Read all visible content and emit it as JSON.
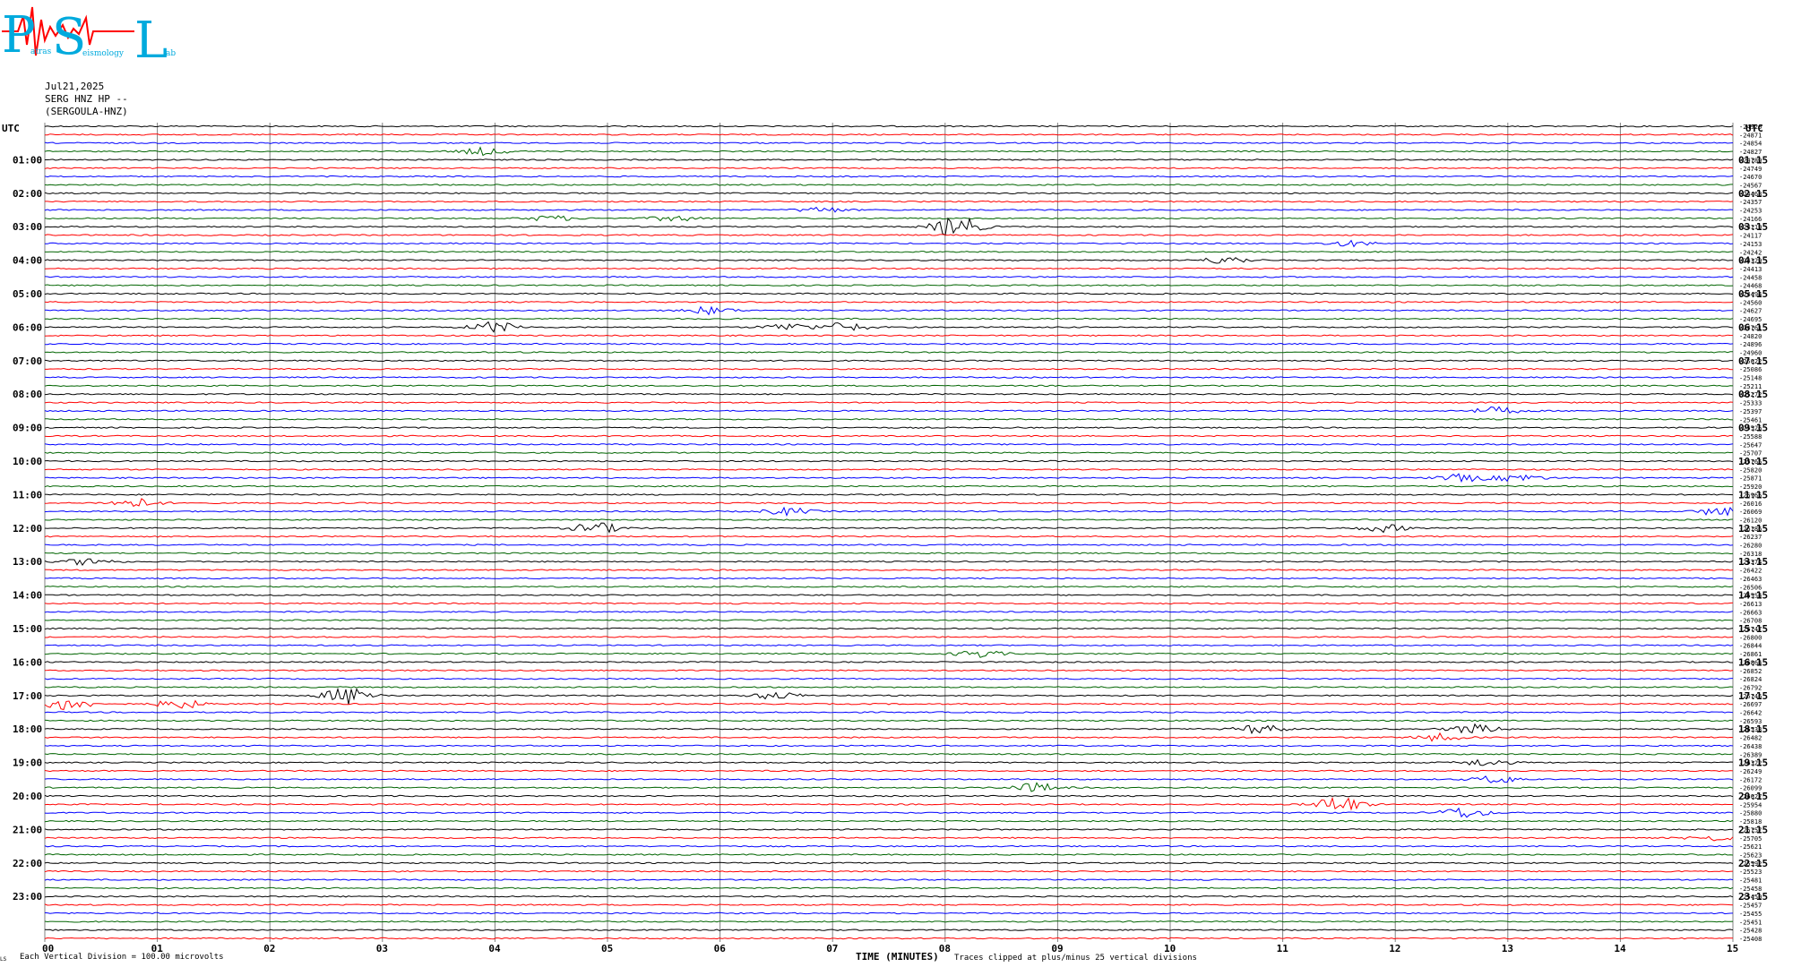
{
  "header": {
    "date": "Jul21,2025",
    "station": "SERG HNZ HP --",
    "station_name": "(SERGOULA-HNZ)"
  },
  "logo": {
    "big_letters": [
      "P",
      "S",
      "L"
    ],
    "small_words": [
      "atras",
      "eismology",
      "ab"
    ]
  },
  "utc_label_left": "UTC",
  "utc_label_right": "UTC",
  "footer": {
    "left_note": "Each Vertical Division =  100.00 microvolts",
    "x_axis_title": "TIME (MINUTES)",
    "clip_note": "Traces clipped at plus/minus 25 vertical divisions",
    "corner_mark": "LS"
  },
  "colors": {
    "black": "#000000",
    "red": "#ff0000",
    "blue": "#0000ff",
    "green": "#006400",
    "grid": "#808080"
  },
  "chart_data": {
    "type": "line",
    "x_ticks": [
      "00",
      "01",
      "02",
      "03",
      "04",
      "05",
      "06",
      "07",
      "08",
      "09",
      "10",
      "11",
      "12",
      "13",
      "14",
      "15"
    ],
    "xlim": [
      0,
      15
    ],
    "left_hour_labels": [
      "01:00",
      "02:00",
      "03:00",
      "04:00",
      "05:00",
      "06:00",
      "07:00",
      "08:00",
      "09:00",
      "10:00",
      "11:00",
      "12:00",
      "13:00",
      "14:00",
      "15:00",
      "16:00",
      "17:00",
      "18:00",
      "19:00",
      "20:00",
      "21:00",
      "22:00",
      "23:00"
    ],
    "right_hour_labels": [
      "01:15",
      "02:15",
      "03:15",
      "04:15",
      "05:15",
      "06:15",
      "07:15",
      "08:15",
      "09:15",
      "10:15",
      "11:15",
      "12:15",
      "13:15",
      "14:15",
      "15:15",
      "16:15",
      "17:15",
      "18:15",
      "19:15",
      "20:15",
      "21:15",
      "22:15",
      "23:15"
    ],
    "trace_color_cycle": [
      "black",
      "red",
      "blue",
      "green"
    ],
    "trace_offsets": [
      -24920,
      -24871,
      -24854,
      -24827,
      -24789,
      -24749,
      -24670,
      -24567,
      -24468,
      -24357,
      -24253,
      -24166,
      -24119,
      -24117,
      -24153,
      -24242,
      -24329,
      -24413,
      -24458,
      -24468,
      -24494,
      -24560,
      -24627,
      -24695,
      -24761,
      -24820,
      -24896,
      -24960,
      -25022,
      -25086,
      -25148,
      -25211,
      -25272,
      -25333,
      -25397,
      -25461,
      -25526,
      -25588,
      -25647,
      -25707,
      -25765,
      -25820,
      -25871,
      -25920,
      -25965,
      -26016,
      -26069,
      -26120,
      -26186,
      -26237,
      -26280,
      -26318,
      -26374,
      -26422,
      -26463,
      -26506,
      -26554,
      -26613,
      -26663,
      -26708,
      -26747,
      -26800,
      -26844,
      -26861,
      -26864,
      -26852,
      -26824,
      -26792,
      -26746,
      -26697,
      -26642,
      -26593,
      -26533,
      -26482,
      -26438,
      -26389,
      -26322,
      -26249,
      -26172,
      -26099,
      -26027,
      -25954,
      -25880,
      -25818,
      -25757,
      -25705,
      -25621,
      -25623,
      -25592,
      -25523,
      -25481,
      -25458,
      -25450,
      -25457,
      -25455,
      -25451,
      -25428,
      -25408
    ],
    "events": [
      {
        "trace": 3,
        "t": 3.9,
        "amp": 4
      },
      {
        "trace": 11,
        "t": 4.5,
        "amp": 3
      },
      {
        "trace": 11,
        "t": 5.6,
        "amp": 3
      },
      {
        "trace": 10,
        "t": 6.9,
        "amp": 3
      },
      {
        "trace": 12,
        "t": 8.1,
        "amp": 12
      },
      {
        "trace": 14,
        "t": 11.6,
        "amp": 3
      },
      {
        "trace": 16,
        "t": 10.5,
        "amp": 4
      },
      {
        "trace": 22,
        "t": 5.9,
        "amp": 4
      },
      {
        "trace": 24,
        "t": 4.0,
        "amp": 6
      },
      {
        "trace": 24,
        "t": 6.6,
        "amp": 4
      },
      {
        "trace": 24,
        "t": 7.1,
        "amp": 5
      },
      {
        "trace": 34,
        "t": 12.9,
        "amp": 4
      },
      {
        "trace": 42,
        "t": 12.6,
        "amp": 4
      },
      {
        "trace": 42,
        "t": 13.1,
        "amp": 4
      },
      {
        "trace": 45,
        "t": 0.8,
        "amp": 5
      },
      {
        "trace": 46,
        "t": 6.6,
        "amp": 4
      },
      {
        "trace": 46,
        "t": 14.9,
        "amp": 5
      },
      {
        "trace": 48,
        "t": 4.9,
        "amp": 6
      },
      {
        "trace": 48,
        "t": 11.9,
        "amp": 4
      },
      {
        "trace": 52,
        "t": 0.4,
        "amp": 4
      },
      {
        "trace": 63,
        "t": 8.3,
        "amp": 4
      },
      {
        "trace": 68,
        "t": 2.7,
        "amp": 10
      },
      {
        "trace": 68,
        "t": 6.5,
        "amp": 4
      },
      {
        "trace": 69,
        "t": 0.2,
        "amp": 7
      },
      {
        "trace": 69,
        "t": 1.2,
        "amp": 5
      },
      {
        "trace": 72,
        "t": 10.8,
        "amp": 5
      },
      {
        "trace": 72,
        "t": 12.7,
        "amp": 5
      },
      {
        "trace": 73,
        "t": 12.4,
        "amp": 4
      },
      {
        "trace": 76,
        "t": 12.8,
        "amp": 4
      },
      {
        "trace": 78,
        "t": 12.9,
        "amp": 4
      },
      {
        "trace": 79,
        "t": 8.8,
        "amp": 5
      },
      {
        "trace": 81,
        "t": 11.5,
        "amp": 9
      },
      {
        "trace": 82,
        "t": 12.6,
        "amp": 6
      },
      {
        "trace": 85,
        "t": 14.8,
        "amp": 3
      }
    ]
  }
}
